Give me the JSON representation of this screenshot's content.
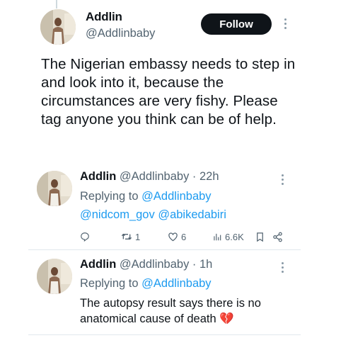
{
  "main_tweet": {
    "name": "Addlin",
    "handle": "@Addlinbaby",
    "follow_label": "Follow",
    "text": "The Nigerian embassy needs to step in and look into it, because the circumstances are very fishy. Please tag anyone you think can be of help."
  },
  "replies": [
    {
      "name": "Addlin",
      "handle_time": "@Addlinbaby · 22h",
      "replying_prefix": "Replying to",
      "replying_to": "@Addlinbaby",
      "mention_1": "@nidcom_gov",
      "mention_2": "@abikedabiri",
      "stats": {
        "replies": "",
        "retweets": "1",
        "likes": "6",
        "views": "6.6K"
      }
    },
    {
      "name": "Addlin",
      "handle_time": "@Addlinbaby · 1h",
      "replying_prefix": "Replying to",
      "replying_to": "@Addlinbaby",
      "text": "The autopsy result says there is no anatomical cause of death",
      "emoji": "💔"
    }
  ],
  "colors": {
    "link": "#1d9bf0",
    "secondary_text": "#536471",
    "follow_bg": "#0f1419",
    "divider": "#e1e8ed"
  },
  "icons": [
    "reply-icon",
    "retweet-icon",
    "like-icon",
    "views-icon",
    "bookmark-icon",
    "share-icon",
    "more-icon"
  ]
}
